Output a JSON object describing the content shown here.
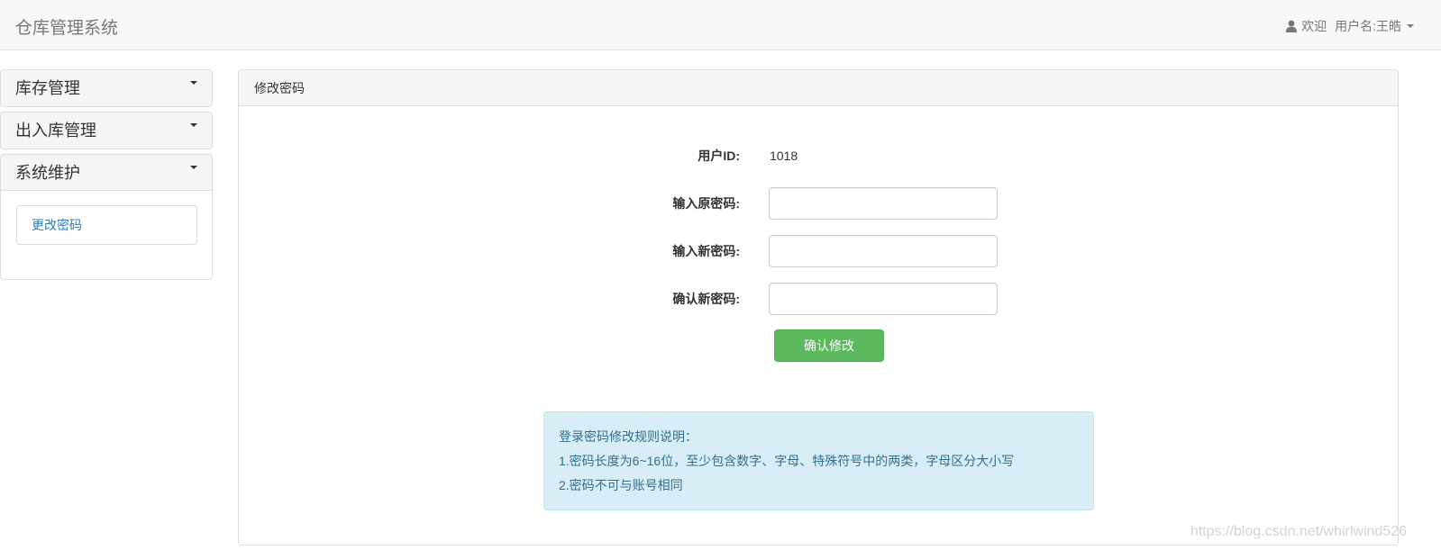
{
  "app": {
    "title": "仓库管理系统"
  },
  "header": {
    "welcome": "欢迎",
    "username": "用户名:王皓"
  },
  "sidebar": {
    "panels": [
      {
        "label": "库存管理"
      },
      {
        "label": "出入库管理"
      },
      {
        "label": "系统维护"
      }
    ],
    "items": [
      {
        "label": "更改密码"
      }
    ]
  },
  "main": {
    "panel_title": "修改密码",
    "form": {
      "user_id_label": "用户ID:",
      "user_id_value": "1018",
      "old_password_label": "输入原密码:",
      "old_password_value": "",
      "new_password_label": "输入新密码:",
      "new_password_value": "",
      "confirm_password_label": "确认新密码:",
      "confirm_password_value": "",
      "submit_label": "确认修改"
    },
    "rules": {
      "title": "登录密码修改规则说明：",
      "line1": "1.密码长度为6~16位，至少包含数字、字母、特殊符号中的两类，字母区分大小写",
      "line2": "2.密码不可与账号相同"
    }
  },
  "watermark": "https://blog.csdn.net/whirlwind526",
  "colors": {
    "primary_button": "#5cb85c",
    "info_background": "#d9edf7",
    "info_text": "#31708f",
    "link": "#337ab7"
  },
  "icons": {
    "user": "user-icon",
    "dropdown": "caret-down-icon"
  }
}
